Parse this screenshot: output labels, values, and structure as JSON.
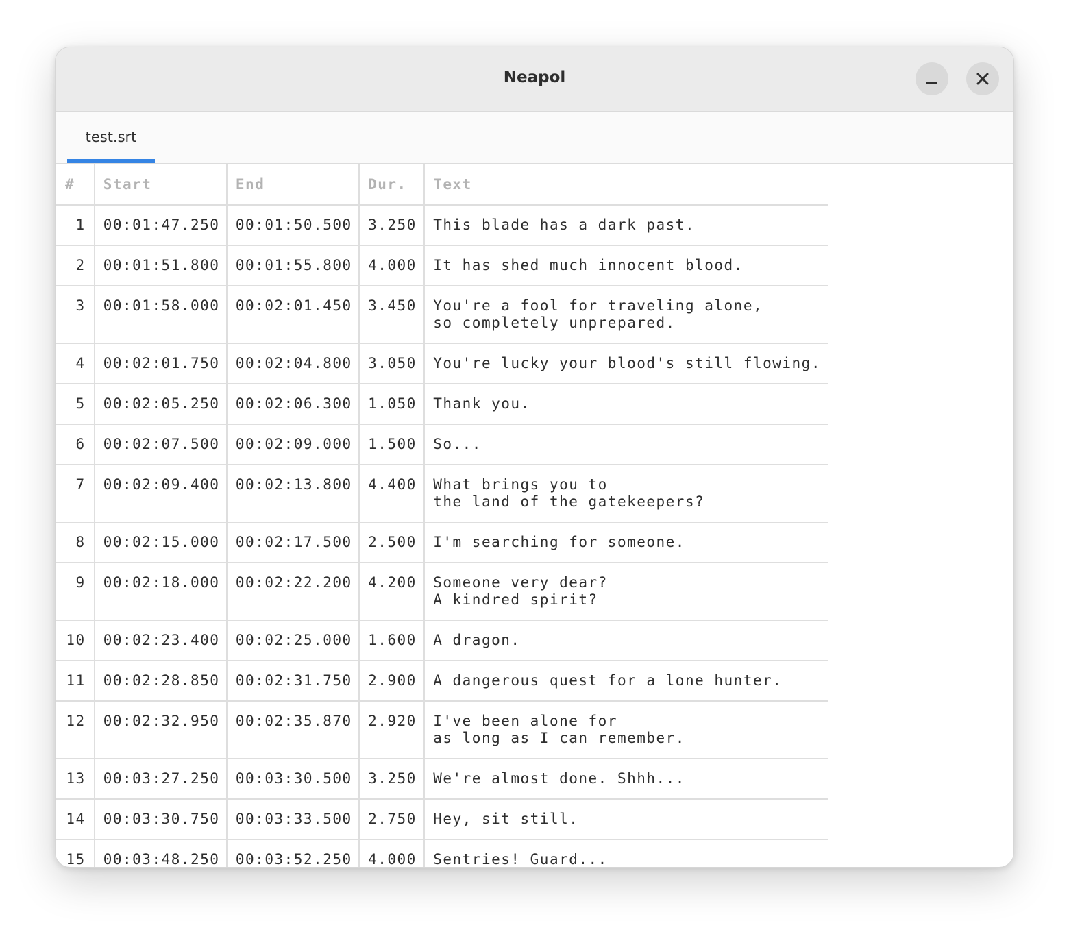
{
  "window": {
    "title": "Neapol",
    "minimize_icon": "minimize-icon",
    "close_icon": "close-icon"
  },
  "tabs": [
    {
      "label": "test.srt",
      "active": true
    }
  ],
  "colors": {
    "accent": "#3584e4",
    "header_text": "#b3b3b3",
    "text": "#2e2e2e",
    "grid": "#dedede",
    "titlebar": "#ebebeb"
  },
  "table": {
    "headers": {
      "num": "#",
      "start": "Start",
      "end": "End",
      "dur": "Dur.",
      "text": "Text"
    },
    "rows": [
      {
        "num": "1",
        "start": "00:01:47.250",
        "end": "00:01:50.500",
        "dur": "3.250",
        "text": "This blade has a dark past."
      },
      {
        "num": "2",
        "start": "00:01:51.800",
        "end": "00:01:55.800",
        "dur": "4.000",
        "text": "It has shed much innocent blood."
      },
      {
        "num": "3",
        "start": "00:01:58.000",
        "end": "00:02:01.450",
        "dur": "3.450",
        "text": "You're a fool for traveling alone,\nso completely unprepared."
      },
      {
        "num": "4",
        "start": "00:02:01.750",
        "end": "00:02:04.800",
        "dur": "3.050",
        "text": "You're lucky your blood's still flowing."
      },
      {
        "num": "5",
        "start": "00:02:05.250",
        "end": "00:02:06.300",
        "dur": "1.050",
        "text": "Thank you."
      },
      {
        "num": "6",
        "start": "00:02:07.500",
        "end": "00:02:09.000",
        "dur": "1.500",
        "text": "So..."
      },
      {
        "num": "7",
        "start": "00:02:09.400",
        "end": "00:02:13.800",
        "dur": "4.400",
        "text": "What brings you to\nthe land of the gatekeepers?"
      },
      {
        "num": "8",
        "start": "00:02:15.000",
        "end": "00:02:17.500",
        "dur": "2.500",
        "text": "I'm searching for someone."
      },
      {
        "num": "9",
        "start": "00:02:18.000",
        "end": "00:02:22.200",
        "dur": "4.200",
        "text": "Someone very dear?\nA kindred spirit?"
      },
      {
        "num": "10",
        "start": "00:02:23.400",
        "end": "00:02:25.000",
        "dur": "1.600",
        "text": "A dragon."
      },
      {
        "num": "11",
        "start": "00:02:28.850",
        "end": "00:02:31.750",
        "dur": "2.900",
        "text": "A dangerous quest for a lone hunter."
      },
      {
        "num": "12",
        "start": "00:02:32.950",
        "end": "00:02:35.870",
        "dur": "2.920",
        "text": "I've been alone for\nas long as I can remember."
      },
      {
        "num": "13",
        "start": "00:03:27.250",
        "end": "00:03:30.500",
        "dur": "3.250",
        "text": "We're almost done. Shhh..."
      },
      {
        "num": "14",
        "start": "00:03:30.750",
        "end": "00:03:33.500",
        "dur": "2.750",
        "text": "Hey, sit still."
      },
      {
        "num": "15",
        "start": "00:03:48.250",
        "end": "00:03:52.250",
        "dur": "4.000",
        "text": "Sentries! Guard..."
      }
    ]
  }
}
